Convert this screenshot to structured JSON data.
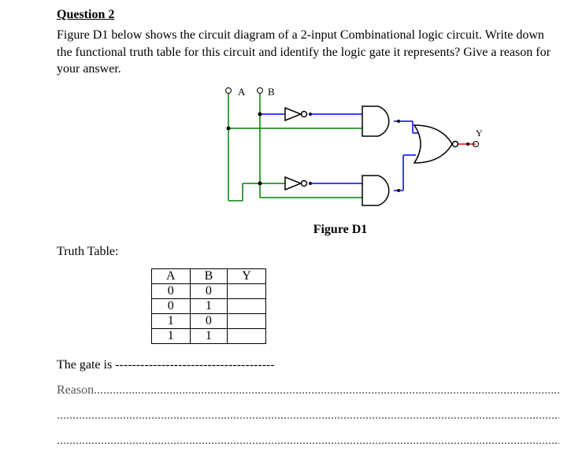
{
  "head": "Question 2",
  "body": "Figure D1 below shows the circuit diagram of a 2-input Combinational logic circuit. Write down the functional truth table for this circuit and identify the logic gate it represents? Give a reason for your answer.",
  "inputs": [
    "A",
    "B"
  ],
  "output": "Y",
  "figure": "Figure D1",
  "tt_label": "Truth Table:",
  "tt_head": [
    "A",
    "B",
    "Y"
  ],
  "tt_rows": [
    [
      "0",
      "0",
      ""
    ],
    [
      "0",
      "1",
      ""
    ],
    [
      "1",
      "0",
      ""
    ],
    [
      "1",
      "1",
      ""
    ]
  ],
  "gate_prefix": "The gate is ",
  "gate_fill": "--------------------------------------",
  "reason_prefix": "Reason",
  "dot1": ".........................................................................................................................................................",
  "dot2": "............................................................................................................................................................................",
  "dot3": "............................................................................................................................................................................"
}
